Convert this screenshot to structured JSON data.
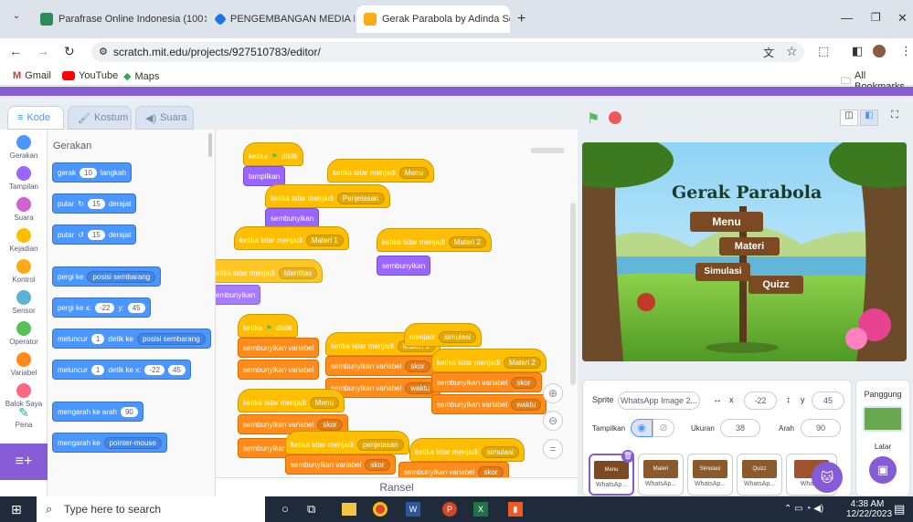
{
  "browser": {
    "tabs": [
      {
        "title": "Parafrase Online Indonesia (100"
      },
      {
        "title": "PENGEMBANGAN MEDIA PEMI"
      },
      {
        "title": "Gerak Parabola by Adinda Septi"
      }
    ],
    "url": "scratch.mit.edu/projects/927510783/editor/",
    "bookmarks": [
      "Gmail",
      "YouTube",
      "Maps"
    ],
    "all_bookmarks": "All Bookmarks"
  },
  "editor": {
    "tabs": [
      "Kode",
      "Kostum",
      "Suara"
    ],
    "categories": [
      {
        "label": "Gerakan",
        "color": "#4c97ff"
      },
      {
        "label": "Tampilan",
        "color": "#9966ff"
      },
      {
        "label": "Suara",
        "color": "#cf63cf"
      },
      {
        "label": "Kejadian",
        "color": "#ffbf00"
      },
      {
        "label": "Kontrol",
        "color": "#ffab19"
      },
      {
        "label": "Sensor",
        "color": "#5cb1d6"
      },
      {
        "label": "Operator",
        "color": "#59c059"
      },
      {
        "label": "Variabel",
        "color": "#ff8c1a"
      },
      {
        "label": "Balok Saya",
        "color": "#ff6680"
      },
      {
        "label": "Pena",
        "color": "#0fbd8c"
      }
    ],
    "palette": {
      "heading": "Gerakan",
      "gerak": "gerak",
      "gerak_val": "10",
      "langkah": "langkah",
      "putar": "putar",
      "derajat": "derajat",
      "putar_val1": "15",
      "putar_val2": "15",
      "pergi_ke": "pergi ke",
      "posisi_sembarang": "posisi sembarang",
      "pergi_ke_x": "pergi ke x:",
      "x_val": "-22",
      "y_label": "y:",
      "y_val": "45",
      "meluncur": "meluncur",
      "meluncur_val": "1",
      "detik_ke": "detik ke",
      "detik_ke_x": "detik ke x:",
      "glide_x": "-22",
      "glide_y": "45",
      "mengarah": "mengarah ke arah",
      "arah_val": "90",
      "mengarah_ke": "mengarah ke",
      "pointer": "pointer-mouse"
    },
    "scripts": {
      "ketika_diklik": "ketika",
      "diklik": "diklik",
      "tampilkan": "tampilkan",
      "sembunyikan": "sembunyikan",
      "ketika_latar": "ketika latar menjadi",
      "menu": "Menu",
      "penjelasan": "Penjelasan",
      "materi1": "Materi 1",
      "materi2": "Materi 2",
      "identitas": "Identitas",
      "sembunyikan_var": "sembunyikan variabel",
      "skor": "skor",
      "waktu": "waktu",
      "simulasi": "simulasi",
      "menjadi": "menjadi",
      "penjelasan_lc": "penjelasan",
      "hidden_label": "Menu"
    },
    "bottom_label": "Ransel"
  },
  "stage": {
    "title": "Gerak Parabola",
    "signs": [
      "Menu",
      "Materi",
      "Simulasi",
      "Quizz"
    ]
  },
  "sprite_info": {
    "sprite_label": "Sprite",
    "sprite_name": "WhatsApp Image 2...",
    "x_label": "x",
    "x_val": "-22",
    "y_label": "y",
    "y_val": "45",
    "show_label": "Tampilkan",
    "size_label": "Ukuran",
    "size_val": "38",
    "dir_label": "Arah",
    "dir_val": "90",
    "thumbs": [
      {
        "label": "WhatsAp..."
      },
      {
        "label": "WhatsAp..."
      },
      {
        "label": "WhatsAp..."
      },
      {
        "label": "WhatsAp..."
      },
      {
        "label": "WhatsA"
      }
    ],
    "thumb_texts": [
      "Menu",
      "Materi",
      "Simulasi",
      "Quizz"
    ]
  },
  "stage_pane": {
    "label": "Panggung",
    "backdrop_label": "Latar"
  },
  "taskbar": {
    "search": "Type here to search",
    "time": "4:38 AM",
    "date": "12/22/2023"
  },
  "colors": {
    "scratch_purple": "#855cd6",
    "scratch_blue": "#4c97ff"
  }
}
